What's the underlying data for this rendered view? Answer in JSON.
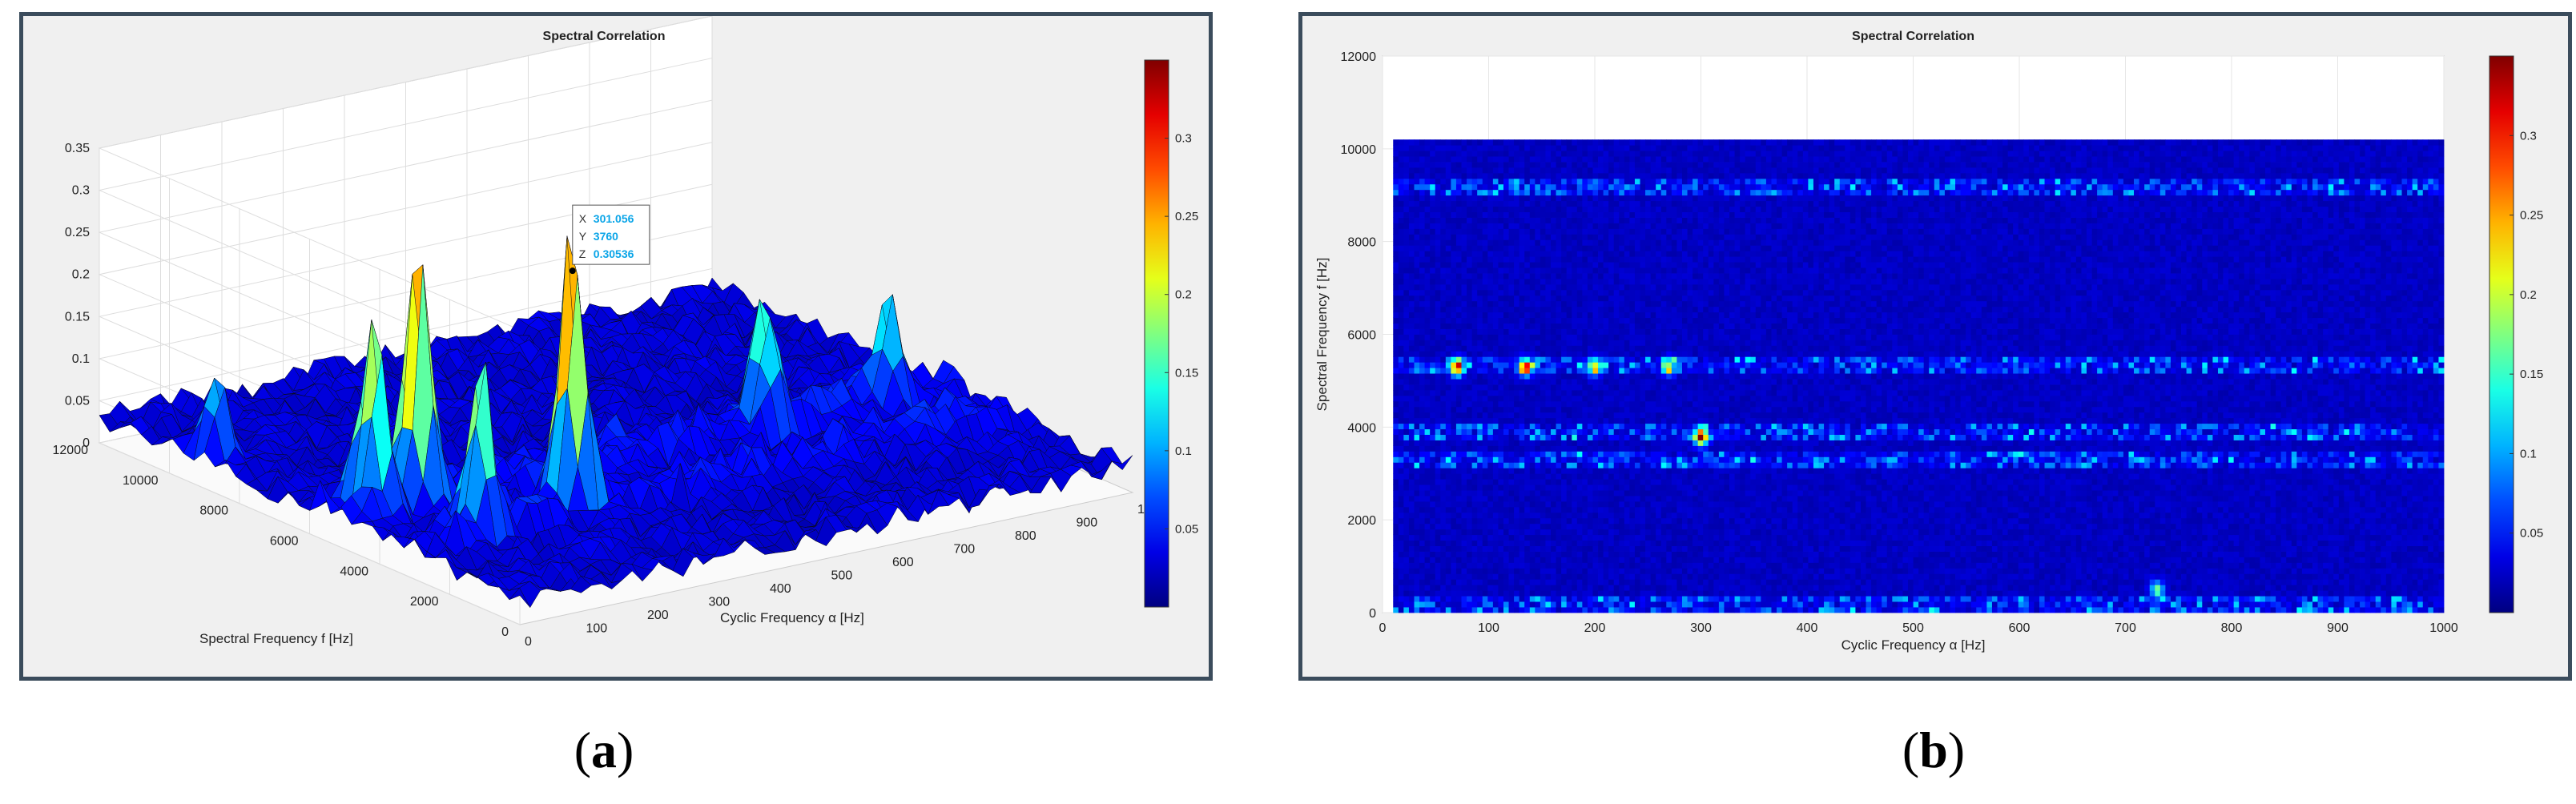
{
  "captions": {
    "a": "a",
    "b": "b"
  },
  "chart_data": [
    {
      "type": "surface",
      "title": "Spectral Correlation",
      "xlabel": "Cyclic Frequency α [Hz]",
      "ylabel": "Spectral Frequency f [Hz]",
      "xlim": [
        0,
        1000
      ],
      "ylim": [
        0,
        12000
      ],
      "zlim": [
        0,
        0.35
      ],
      "x_ticks": [
        "0",
        "100",
        "200",
        "300",
        "400",
        "500",
        "600",
        "700",
        "800",
        "900",
        "1000"
      ],
      "y_ticks": [
        "0",
        "2000",
        "4000",
        "6000",
        "8000",
        "10000",
        "12000"
      ],
      "z_ticks": [
        "0",
        "0.05",
        "0.1",
        "0.15",
        "0.2",
        "0.25",
        "0.3",
        "0.35"
      ],
      "colorbar_ticks": [
        "0.05",
        "0.1",
        "0.15",
        "0.2",
        "0.25",
        "0.3"
      ],
      "colorbar_range": [
        0,
        0.35
      ],
      "colormap": "jet",
      "grid": true,
      "datatip": {
        "x": "301.056",
        "y": "3760",
        "z": "0.30536"
      },
      "peaks": [
        {
          "alpha": 65,
          "f": 5300,
          "value": 0.22
        },
        {
          "alpha": 135,
          "f": 5250,
          "value": 0.3
        },
        {
          "alpha": 130,
          "f": 3400,
          "value": 0.18
        },
        {
          "alpha": 301,
          "f": 3760,
          "value": 0.305
        },
        {
          "alpha": 700,
          "f": 5300,
          "value": 0.16
        },
        {
          "alpha": 900,
          "f": 5200,
          "value": 0.12
        },
        {
          "alpha": 30,
          "f": 9200,
          "value": 0.1
        }
      ]
    },
    {
      "type": "heatmap",
      "title": "Spectral Correlation",
      "xlabel": "Cyclic Frequency α [Hz]",
      "ylabel": "Spectral Frequency f [Hz]",
      "xlim": [
        0,
        1000
      ],
      "ylim": [
        0,
        12000
      ],
      "x_ticks": [
        "0",
        "100",
        "200",
        "300",
        "400",
        "500",
        "600",
        "700",
        "800",
        "900",
        "1000"
      ],
      "y_ticks": [
        "0",
        "2000",
        "4000",
        "6000",
        "8000",
        "10000",
        "12000"
      ],
      "colorbar_ticks": [
        "0.05",
        "0.1",
        "0.15",
        "0.2",
        "0.25",
        "0.3"
      ],
      "colorbar_range": [
        0,
        0.35
      ],
      "colormap": "jet",
      "data_extent": {
        "alpha": [
          10,
          1000
        ],
        "f": [
          0,
          10200
        ]
      },
      "bands_f": [
        5300,
        3900,
        3300,
        9200,
        200
      ],
      "hotspots": [
        {
          "alpha": 70,
          "f": 5300,
          "value": 0.28
        },
        {
          "alpha": 135,
          "f": 5300,
          "value": 0.25
        },
        {
          "alpha": 300,
          "f": 3800,
          "value": 0.3
        },
        {
          "alpha": 200,
          "f": 5300,
          "value": 0.18
        },
        {
          "alpha": 270,
          "f": 5300,
          "value": 0.16
        },
        {
          "alpha": 730,
          "f": 500,
          "value": 0.15
        }
      ]
    }
  ]
}
